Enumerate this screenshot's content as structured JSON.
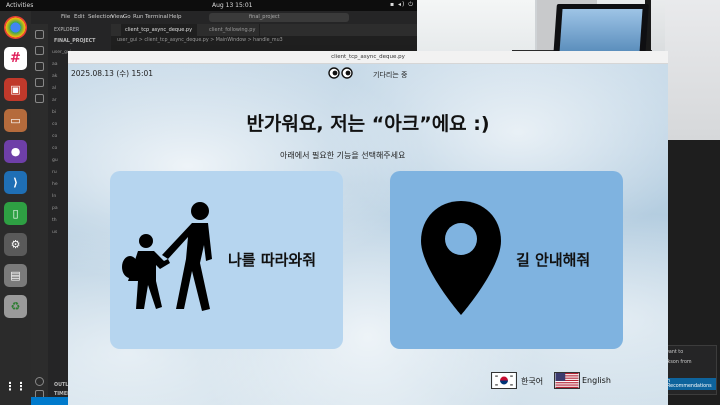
{
  "topbar": {
    "activities": "Activities",
    "clock": "Aug 13  15:01"
  },
  "vscode": {
    "menu": [
      "File",
      "Edit",
      "Selection",
      "View",
      "Go",
      "Run",
      "Terminal",
      "Help"
    ],
    "search": "final_project",
    "explorer_title": "EXPLORER",
    "project": "FINAL_PROJECT",
    "tree": [
      "user_gui",
      "aa",
      "ak",
      "al",
      "ar",
      "bi",
      "co",
      "co",
      "co",
      "gu",
      "ru",
      "he",
      "In",
      "pa",
      "th",
      "us"
    ],
    "tabs": [
      "client_tcp_async_deque.py",
      "client_following.py"
    ],
    "breadcrumb": "user_gui > client_tcp_async_deque.py > MainWindow > handle_mu3",
    "outline": "OUTLINE",
    "timeline": "TIMELINE",
    "notification": [
      "want to",
      "ckson from",
      "n Recommendations"
    ],
    "status_right": "final_project_venv"
  },
  "app": {
    "window_title": "client_tcp_async_deque.py",
    "datetime": "2025.08.13 (수) 15:01",
    "status": "기다리는 중",
    "greeting": "반가워요, 저는 “아크”에요 :)",
    "instruction": "아래에서 필요한 기능을 선택해주세요",
    "follow_label": "나를 따라와줘",
    "guide_label": "길 안내해줘",
    "lang_korean": "한국어",
    "lang_english": "English"
  }
}
